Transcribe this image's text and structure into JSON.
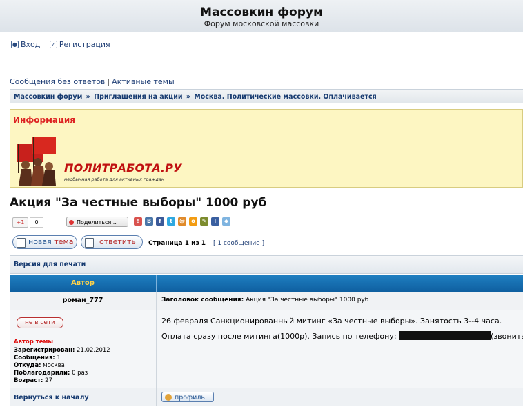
{
  "header": {
    "title": "Массовкин форум",
    "subtitle": "Форум московской массовки"
  },
  "userlinks": {
    "login": "Вход",
    "register": "Регистрация"
  },
  "quicklinks": {
    "unanswered": "Сообщения без ответов",
    "separator": "|",
    "active": "Активные темы"
  },
  "breadcrumb": {
    "items": [
      "Массовкин форум",
      "Приглашения на акции",
      "Москва. Политические массовки. Оплачивается"
    ],
    "separator": "»"
  },
  "info": {
    "title": "Информация",
    "banner_name": "ПОЛИТРАБОТА.РУ",
    "banner_tagline": "необычная работа для активных граждан"
  },
  "topic": {
    "title": "Акция \"За честные выборы\" 1000 руб"
  },
  "social": {
    "gplus": "+1",
    "gplus_count": "0",
    "share_label": "Поделиться..."
  },
  "actions": {
    "new_topic_a": "новая",
    "new_topic_b": "тема",
    "reply": "ответить",
    "page_info": "Страница 1 из 1",
    "message_count": "[ 1 сообщение ]"
  },
  "print_version": "Версия для печати",
  "table": {
    "author_header": "Автор"
  },
  "post": {
    "author": "роман_777",
    "subject_label": "Заголовок сообщения:",
    "subject": "Акция \"За честные выборы\" 1000 руб",
    "status": "не в сети",
    "author_tag": "Автор темы",
    "registered_label": "Зарегистрирован:",
    "registered": "21.02.2012",
    "messages_label": "Сообщения:",
    "messages": "1",
    "from_label": "Откуда:",
    "from": "москва",
    "thanked_label": "Поблагодарили:",
    "thanked": "0 раз",
    "age_label": "Возраст:",
    "age": "27",
    "body_line1": "26 февраля Санкционированный митинг «За честные выборы». Занятость 3--4 часа.",
    "body_line2_start": "Оплата сразу после митинга(1000р). Запись по телефону:",
    "body_line2_end": "(звонить мо"
  },
  "footer_row": {
    "back_to_top": "Вернуться к началу",
    "profile": "профиль"
  },
  "colors": {
    "accent": "#1f3e75",
    "header_bar": "#1570b5",
    "info_bg": "#fdf6c2",
    "red": "#d22222"
  }
}
